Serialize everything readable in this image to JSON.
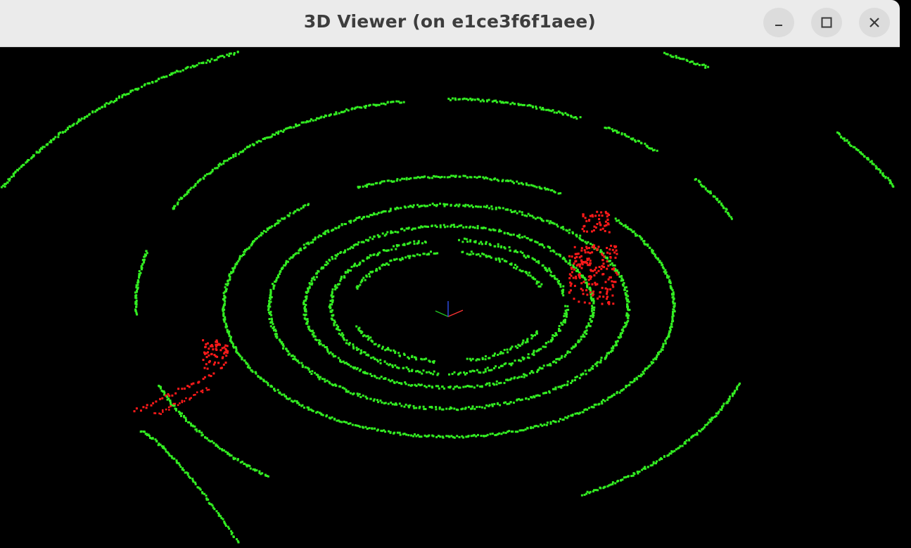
{
  "window": {
    "title": "3D Viewer (on e1ce3f6f1aee)"
  },
  "controls": {
    "minimize_icon": "minimize-icon",
    "maximize_icon": "maximize-icon",
    "close_icon": "close-icon"
  },
  "scene": {
    "background_color": "#000000",
    "ground_point_color": "#33ee22",
    "obstacle_point_color": "#ff1a1a",
    "axis_colors": {
      "x": "#ff3333",
      "y": "#22cc22",
      "z": "#3355ff"
    }
  }
}
